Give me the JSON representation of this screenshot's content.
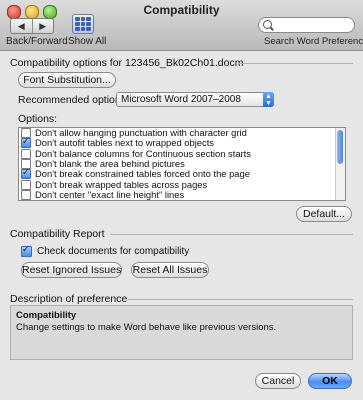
{
  "window": {
    "title": "Compatibility"
  },
  "toolbar": {
    "back_forward_label": "Back/Forward",
    "show_all_label": "Show All",
    "search_placeholder": "",
    "search_caption": "Search Word Preferences"
  },
  "options_section": {
    "title": "Compatibility options for 123456_Bk02Ch01.docm",
    "font_substitution_button": "Font Substitution...",
    "recommended_label": "Recommended options for:",
    "recommended_value": "Microsoft Word 2007–2008",
    "options_label": "Options:",
    "items": [
      {
        "label": "Don't allow hanging punctuation with character grid",
        "checked": false
      },
      {
        "label": "Don't autofit tables next to wrapped objects",
        "checked": true
      },
      {
        "label": "Don't balance columns for Continuous section starts",
        "checked": false
      },
      {
        "label": "Don't blank the area behind pictures",
        "checked": false
      },
      {
        "label": "Don't break constrained tables forced onto the page",
        "checked": true
      },
      {
        "label": "Don't break wrapped tables across pages",
        "checked": false
      },
      {
        "label": "Don't center \"exact line height\" lines",
        "checked": false
      }
    ],
    "default_button": "Default..."
  },
  "report_section": {
    "title": "Compatibility Report",
    "check_label": "Check documents for compatibility",
    "check_checked": true,
    "reset_ignored_button": "Reset Ignored Issues",
    "reset_all_button": "Reset All Issues"
  },
  "description": {
    "section_title": "Description of preference",
    "heading": "Compatibility",
    "text": "Change settings to make Word behave like previous versions."
  },
  "footer": {
    "cancel_button": "Cancel",
    "ok_button": "OK"
  }
}
